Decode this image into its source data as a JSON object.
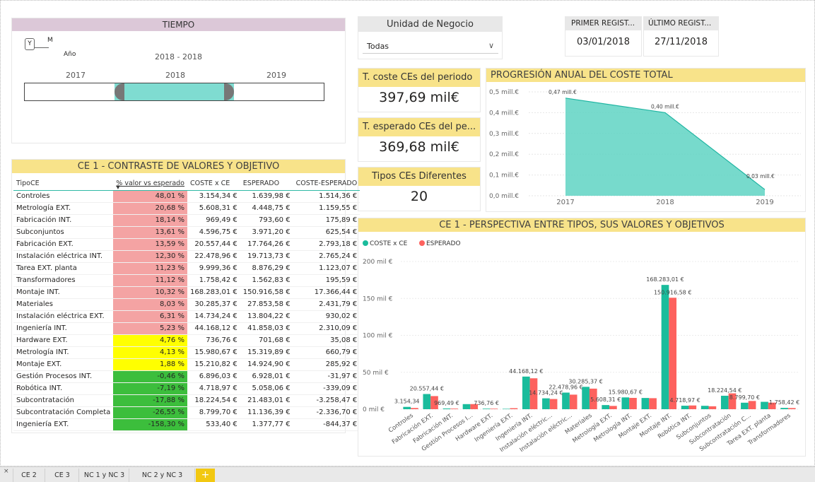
{
  "tiempo": {
    "title": "TIEMPO",
    "granularity_y": "Y",
    "granularity_m": "M",
    "granularity_label": "Año",
    "range": "2018 - 2018",
    "years": [
      "2017",
      "2018",
      "2019"
    ],
    "selected_start_fraction": 0.3,
    "selected_end_fraction": 0.7
  },
  "unidad": {
    "title": "Unidad de Negocio",
    "value": "Todas"
  },
  "primer": {
    "title": "PRIMER REGIST...",
    "value": "03/01/2018"
  },
  "ultimo": {
    "title": "ÚLTIMO REGIST...",
    "value": "27/11/2018"
  },
  "kpi1": {
    "title": "T. coste CEs del periodo",
    "value": "397,69 mil€"
  },
  "kpi2": {
    "title": "T. esperado CEs del pe...",
    "value": "369,68 mil€"
  },
  "kpi3": {
    "title": "Tipos CEs Diferentes",
    "value": "20"
  },
  "table": {
    "title": "CE 1 - CONTRASTE DE VALORES Y OBJETIVO",
    "headers": [
      "TipoCE",
      "% valor vs esperado",
      "COSTE x CE",
      "ESPERADO",
      "COSTE-ESPERADO"
    ],
    "rows": [
      [
        "Controles",
        "48,01 %",
        "3.154,34 €",
        "1.639,98 €",
        "1.514,36 €",
        "#f4a3a3"
      ],
      [
        "Metrología EXT.",
        "20,68 %",
        "5.608,31 €",
        "4.448,75 €",
        "1.159,55 €",
        "#f4a3a3"
      ],
      [
        "Fabricación INT.",
        "18,14 %",
        "969,49 €",
        "793,60 €",
        "175,89 €",
        "#f4a3a3"
      ],
      [
        "Subconjuntos",
        "13,61 %",
        "4.596,75 €",
        "3.971,20 €",
        "625,54 €",
        "#f4a3a3"
      ],
      [
        "Fabricación EXT.",
        "13,59 %",
        "20.557,44 €",
        "17.764,26 €",
        "2.793,18 €",
        "#f4a3a3"
      ],
      [
        "Instalación eléctrica INT.",
        "12,30 %",
        "22.478,96 €",
        "19.713,73 €",
        "2.765,24 €",
        "#f4a3a3"
      ],
      [
        "Tarea EXT. planta",
        "11,23 %",
        "9.999,36 €",
        "8.876,29 €",
        "1.123,07 €",
        "#f4a3a3"
      ],
      [
        "Transformadores",
        "11,12 %",
        "1.758,42 €",
        "1.562,83 €",
        "195,59 €",
        "#f4a3a3"
      ],
      [
        "Montaje INT.",
        "10,32 %",
        "168.283,01 €",
        "150.916,58 €",
        "17.366,44 €",
        "#f4a3a3"
      ],
      [
        "Materiales",
        "8,03 %",
        "30.285,37 €",
        "27.853,58 €",
        "2.431,79 €",
        "#f4a3a3"
      ],
      [
        "Instalación eléctrica EXT.",
        "6,31 %",
        "14.734,24 €",
        "13.804,22 €",
        "930,02 €",
        "#f4a3a3"
      ],
      [
        "Ingeniería INT.",
        "5,23 %",
        "44.168,12 €",
        "41.858,03 €",
        "2.310,09 €",
        "#f4a3a3"
      ],
      [
        "Hardware EXT.",
        "4,76 %",
        "736,76 €",
        "701,68 €",
        "35,08 €",
        "#ffff00"
      ],
      [
        "Metrología INT.",
        "4,13 %",
        "15.980,67 €",
        "15.319,89 €",
        "660,79 €",
        "#ffff00"
      ],
      [
        "Montaje EXT.",
        "1,88 %",
        "15.210,82 €",
        "14.924,90 €",
        "285,92 €",
        "#ffff00"
      ],
      [
        "Gestión Procesos INT.",
        "-0,46 %",
        "6.896,03 €",
        "6.928,01 €",
        "-31,97 €",
        "#3cbe3c"
      ],
      [
        "Robótica INT.",
        "-7,19 %",
        "4.718,97 €",
        "5.058,06 €",
        "-339,09 €",
        "#3cbe3c"
      ],
      [
        "Subcontratación",
        "-17,88 %",
        "18.224,54 €",
        "21.483,01 €",
        "-3.258,47 €",
        "#3cbe3c"
      ],
      [
        "Subcontratación Completa",
        "-26,55 %",
        "8.799,70 €",
        "11.136,39 €",
        "-2.336,70 €",
        "#3cbe3c"
      ],
      [
        "Ingeniería EXT.",
        "-158,30 %",
        "533,40 €",
        "1.377,77 €",
        "-844,37 €",
        "#3cbe3c"
      ]
    ]
  },
  "chart_data": [
    {
      "type": "area",
      "title": "PROGRESIÓN ANUAL DEL COSTE TOTAL",
      "x": [
        "2017",
        "2018",
        "2019"
      ],
      "values": [
        0.47,
        0.4,
        0.03
      ],
      "point_labels": [
        "0,47 mill.€",
        "0,40 mill.€",
        "0,03 mill.€"
      ],
      "yticks": [
        "0,0 mill.€",
        "0,1 mill.€",
        "0,2 mill.€",
        "0,3 mill.€",
        "0,4 mill.€",
        "0,5 mill.€"
      ],
      "ylim": [
        0,
        0.5
      ],
      "color": "#5fd3c3"
    },
    {
      "type": "bar",
      "title": "CE 1 - PERSPECTIVA ENTRE TIPOS, SUS VALORES Y OBJETIVOS",
      "legend_position": "top-left",
      "categories": [
        "Controles",
        "Fabricación EXT.",
        "Fabricación INT.",
        "Gestión Procesos I...",
        "Hardware EXT.",
        "Ingeniería EXT.",
        "Ingeniería INT.",
        "Instalación eléctric...",
        "Instalación eléctric...",
        "Materiales",
        "Metrología EXT.",
        "Metrología INT.",
        "Montaje EXT.",
        "Montaje INT.",
        "Robótica INT.",
        "Subconjuntos",
        "Subcontratación",
        "Subcontratación C...",
        "Tarea EXT. planta",
        "Transformadores"
      ],
      "series": [
        {
          "name": "COSTE x CE",
          "color": "#1abc9c",
          "values": [
            3154.34,
            20557.44,
            969.49,
            6896.03,
            736.76,
            533.4,
            44168.12,
            14734.24,
            22478.96,
            30285.37,
            5608.31,
            15980.67,
            15210.82,
            168283.01,
            4718.97,
            4596.75,
            18224.54,
            8799.7,
            9999.36,
            1758.42
          ]
        },
        {
          "name": "ESPERADO",
          "color": "#fd625e",
          "values": [
            1639.98,
            17764.26,
            793.6,
            6928.01,
            701.68,
            1377.77,
            41858.03,
            13804.22,
            19713.73,
            27853.58,
            4448.75,
            15319.89,
            14924.9,
            150916.58,
            5058.06,
            3971.2,
            21483.01,
            11136.39,
            8876.29,
            1562.83
          ]
        }
      ],
      "data_labels": [
        {
          "i": 0,
          "text": "3.154,34"
        },
        {
          "i": 1,
          "text": "20.557,44 €"
        },
        {
          "i": 2,
          "text": "969,49 €"
        },
        {
          "i": 4,
          "text": "736,76 €"
        },
        {
          "i": 6,
          "text": "44.168,12 €"
        },
        {
          "i": 7,
          "text": "14.734,24 €"
        },
        {
          "i": 8,
          "text": "22.478,96 €"
        },
        {
          "i": 9,
          "text": "30.285,37 €"
        },
        {
          "i": 10,
          "text": "5.608,31 €"
        },
        {
          "i": 11,
          "text": "15.980,67 €"
        },
        {
          "i": 13,
          "text": "168.283,01 €"
        },
        {
          "i": 13,
          "text": "150.916,58 €",
          "series": 1
        },
        {
          "i": 14,
          "text": "4.718,97 €"
        },
        {
          "i": 16,
          "text": "18.224,54 €"
        },
        {
          "i": 17,
          "text": "8.799,70 €"
        },
        {
          "i": 19,
          "text": "1.758,42 €"
        }
      ],
      "yticks": [
        "0 mil €",
        "50 mil €",
        "100 mil €",
        "150 mil €",
        "200 mil €"
      ],
      "ylim": [
        0,
        200000
      ]
    }
  ],
  "tabs": [
    "CE 2",
    "CE 3",
    "NC 1 y NC 3",
    "NC 2 y NC 3"
  ],
  "tab_add": "+"
}
